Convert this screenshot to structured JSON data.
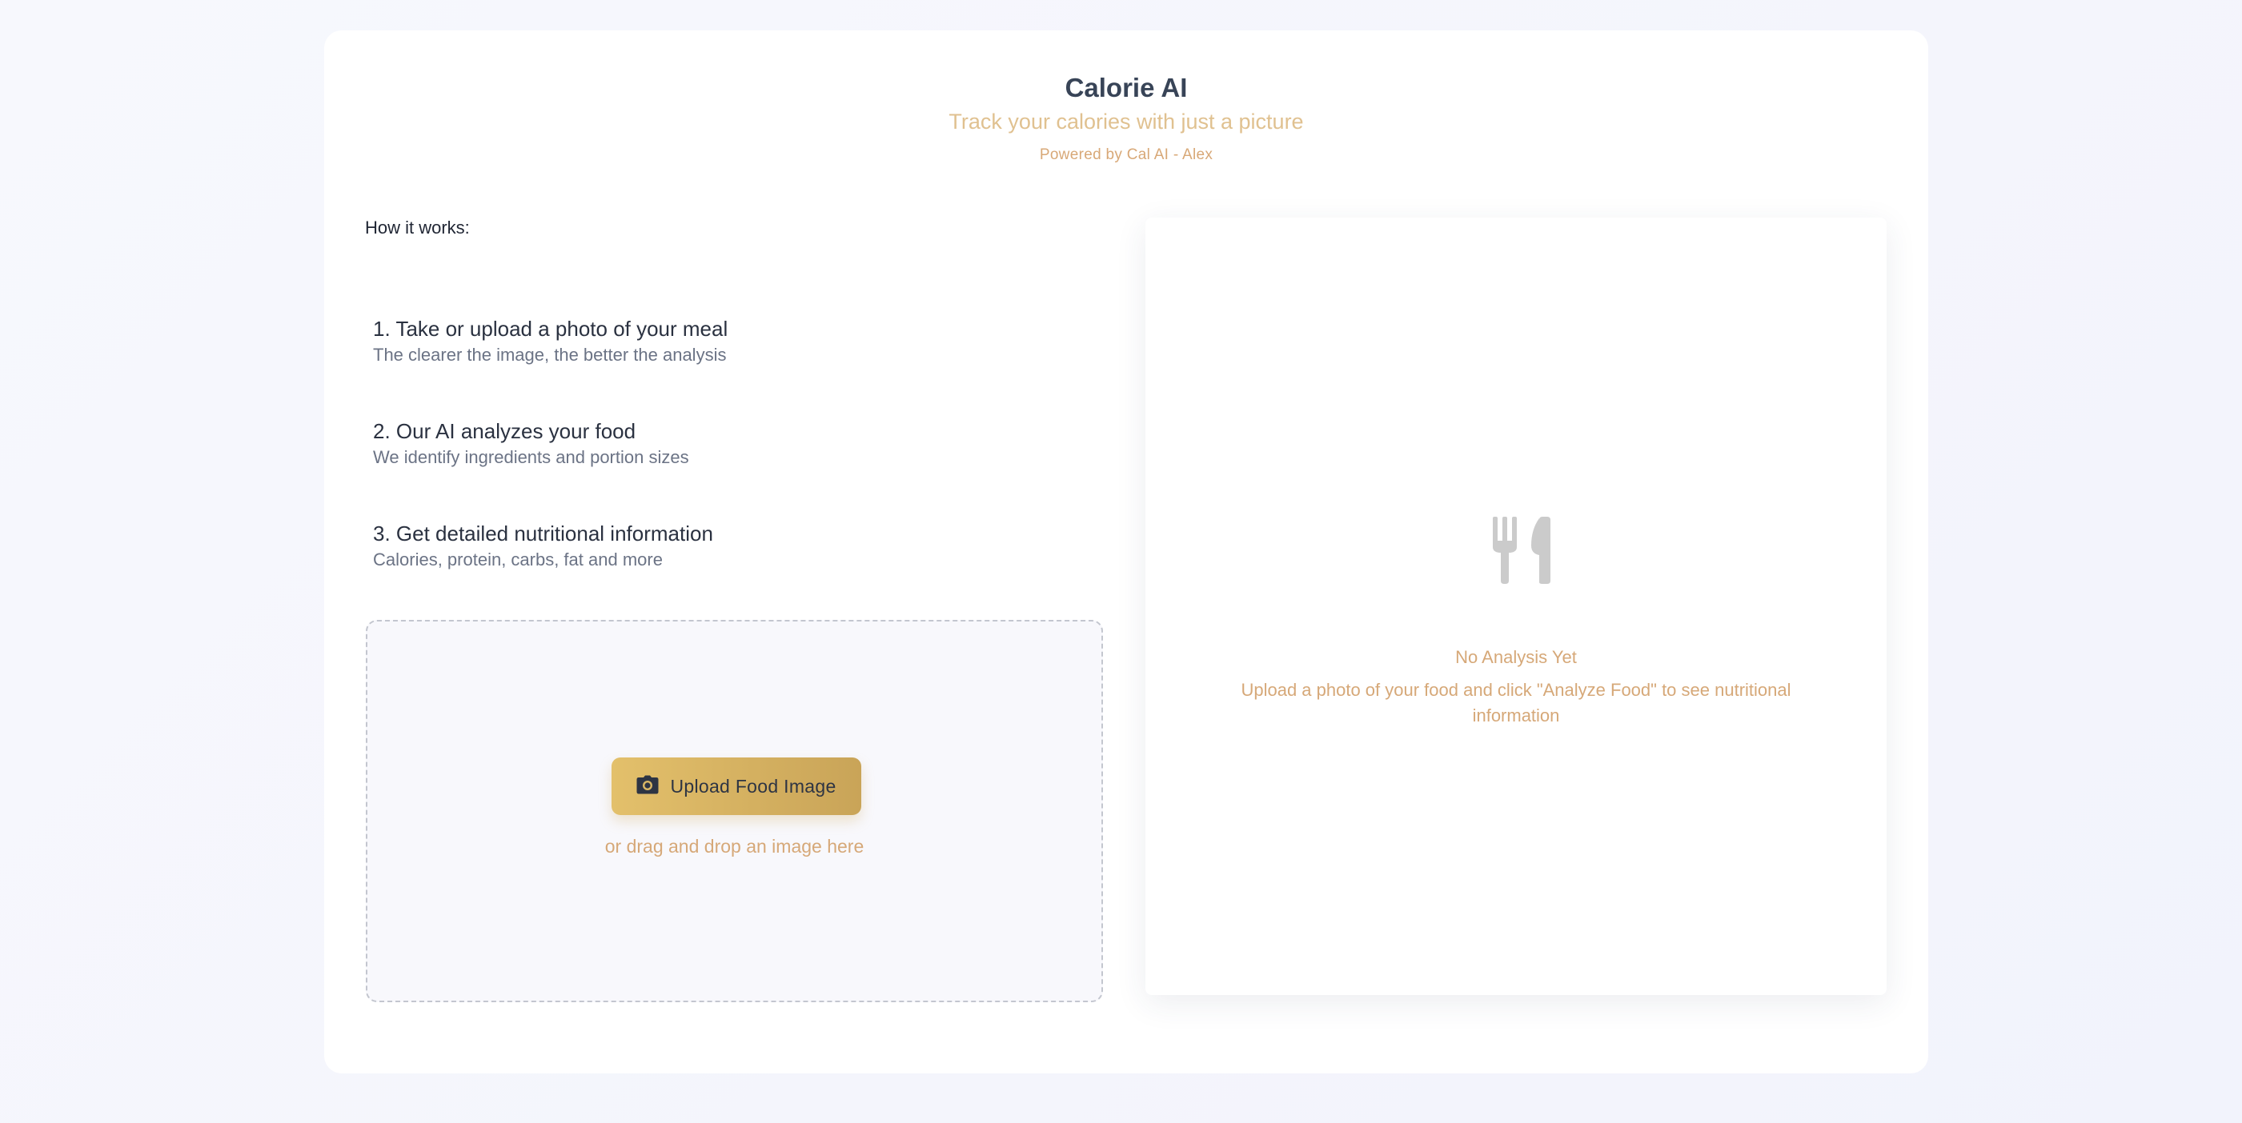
{
  "header": {
    "title": "Calorie AI",
    "subtitle": "Track your calories with just a picture",
    "powered_by": "Powered by Cal AI - Alex"
  },
  "how_it_works": {
    "title": "How it works:",
    "steps": [
      {
        "title": "1. Take or upload a photo of your meal",
        "description": "The clearer the image, the better the analysis"
      },
      {
        "title": "2. Our AI analyzes your food",
        "description": "We identify ingredients and portion sizes"
      },
      {
        "title": "3. Get detailed nutritional information",
        "description": "Calories, protein, carbs, fat and more"
      }
    ]
  },
  "upload": {
    "button_label": "Upload Food Image",
    "button_icon": "camera-icon",
    "drag_hint": "or drag and drop an image here"
  },
  "results": {
    "icon": "utensils-icon",
    "empty_title": "No Analysis Yet",
    "empty_description": "Upload a photo of your food and click \"Analyze Food\" to see nutritional information"
  },
  "colors": {
    "accent_gold": "#d4b062",
    "muted_orange": "#d6a878",
    "title_slate": "#384457"
  }
}
